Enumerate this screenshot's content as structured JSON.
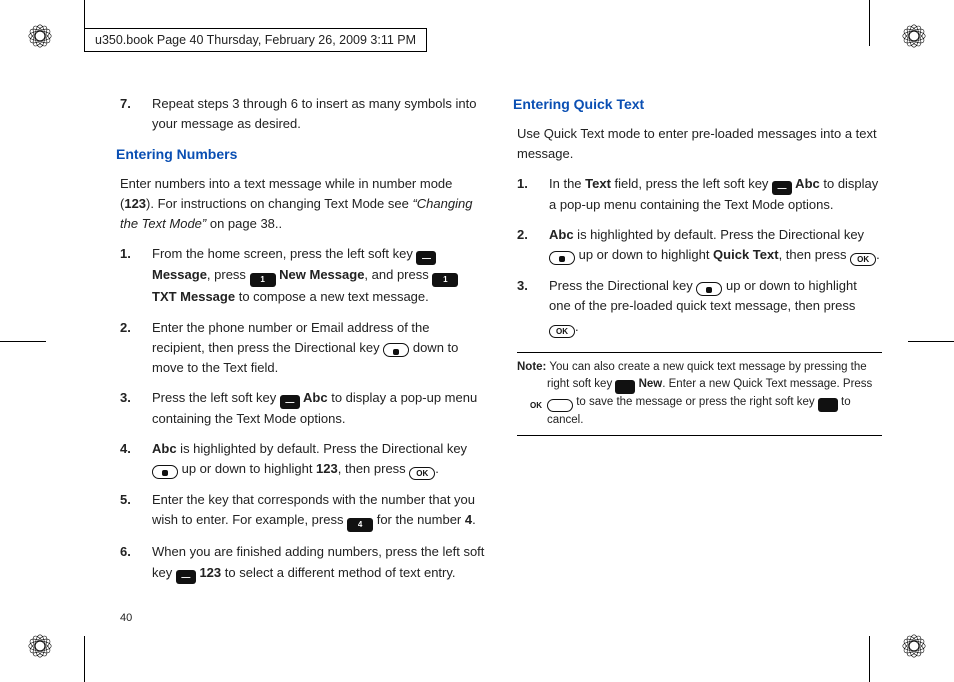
{
  "header": {
    "crop_label": "u350.book  Page 40  Thursday, February 26, 2009  3:11 PM"
  },
  "folio": "40",
  "left": {
    "cont7": "Repeat steps 3 through 6 to insert as many symbols into your message as desired.",
    "heading_numbers": "Entering Numbers",
    "numbers_intro_a": "Enter numbers into a text message while in number mode (",
    "numbers_intro_b": "123",
    "numbers_intro_c": "). For instructions on changing Text Mode see ",
    "numbers_intro_ref": "“Changing the Text Mode”",
    "numbers_intro_d": " on page 38..",
    "s1a": "From the home screen, press the left soft key ",
    "s1b": "Message",
    "s1c": ", press ",
    "s1_key1": "1",
    "s1d": " New Message",
    "s1e": ", and press ",
    "s1_key2": "1",
    "s1f": " TXT Message",
    "s1g": " to compose a new text message.",
    "s2a": "Enter the phone number or Email address of the recipient, then press the Directional key ",
    "s2b": " down to move to the Text field.",
    "s3a": "Press the left soft key ",
    "s3b": " Abc",
    "s3c": " to display a pop-up menu containing the Text Mode options.",
    "s4a": "Abc",
    "s4b": " is highlighted by default. Press the Directional key ",
    "s4c": " up or down to highlight ",
    "s4d": "123",
    "s4e": ", then press ",
    "s4f": ".",
    "s5a": "Enter the key that corresponds with the number that you wish to enter. For example, press ",
    "s5_key": "4",
    "s5b": " for the number ",
    "s5c": "4",
    "s5d": ".",
    "s6a": "When you are finished adding numbers, press the left soft key ",
    "s6b": " 123",
    "s6c": " to select a different method of text entry."
  },
  "right": {
    "heading_quick": "Entering Quick Text",
    "quick_intro": "Use Quick Text mode to enter pre-loaded messages into a text message.",
    "q1a": "In the ",
    "q1b": "Text",
    "q1c": " field, press the left soft key ",
    "q1d": " Abc",
    "q1e": " to display a pop-up menu containing the Text Mode options.",
    "q2a": "Abc",
    "q2b": " is highlighted by default. Press the Directional key ",
    "q2c": " up or down to highlight ",
    "q2d": "Quick Text",
    "q2e": ", then press ",
    "q2f": ".",
    "q3a": "Press the Directional key ",
    "q3b": " up or down to highlight one of the pre-loaded quick text message, then press ",
    "q3c": ".",
    "note_lead": "Note:",
    "note_a": " You can also create a new quick text message by pressing the right soft key ",
    "note_b": " New",
    "note_c": ". Enter a new Quick Text message. Press ",
    "note_d": " to save the message or press the right soft key ",
    "note_e": " to cancel."
  },
  "keys": {
    "ok_label": "OK"
  }
}
